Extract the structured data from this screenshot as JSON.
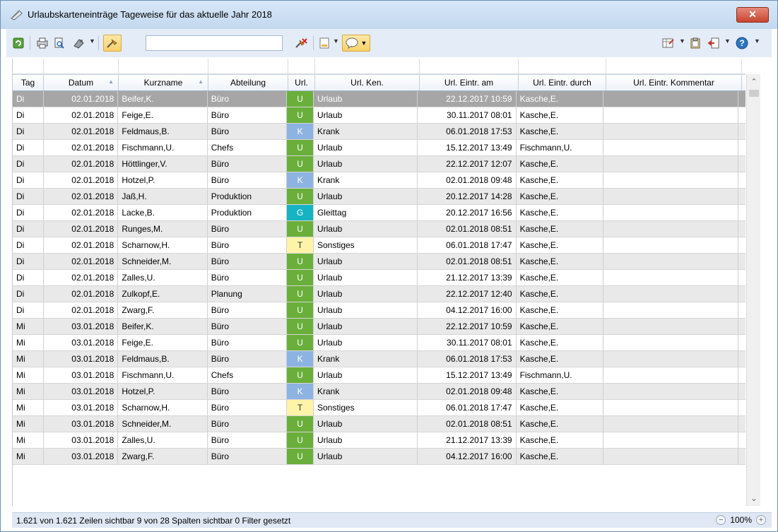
{
  "window": {
    "title": "Urlaubskarteneinträge Tageweise für das aktuelle Jahr 2018",
    "close_label": "x"
  },
  "toolbar": {
    "search_value": "",
    "icons": [
      "refresh-icon",
      "print-icon",
      "print-preview-icon",
      "export-icon",
      "filter-icon",
      "clear-filter-icon",
      "document-icon",
      "comment-icon",
      "layout-icon",
      "clipboard-icon",
      "exit-icon",
      "help-icon"
    ]
  },
  "columns": [
    "Tag",
    "Datum",
    "Kurzname",
    "Abteilung",
    "Url.",
    "Url. Ken.",
    "Url. Eintr. am",
    "Url. Eintr. durch",
    "Url. Eintr. Kommentar"
  ],
  "code_colors": {
    "U": "#6aaf3a",
    "K": "#8db3e2",
    "G": "#16b3c2",
    "T": "#fff3a8"
  },
  "rows": [
    {
      "tag": "Di",
      "datum": "02.01.2018",
      "kurz": "Beifer,K.",
      "abt": "Büro",
      "url": "U",
      "ken": "Urlaub",
      "am": "22.12.2017 10:59",
      "durch": "Kasche,E."
    },
    {
      "tag": "Di",
      "datum": "02.01.2018",
      "kurz": "Feige,E.",
      "abt": "Büro",
      "url": "U",
      "ken": "Urlaub",
      "am": "30.11.2017 08:01",
      "durch": "Kasche,E."
    },
    {
      "tag": "Di",
      "datum": "02.01.2018",
      "kurz": "Feldmaus,B.",
      "abt": "Büro",
      "url": "K",
      "ken": "Krank",
      "am": "06.01.2018 17:53",
      "durch": "Kasche,E."
    },
    {
      "tag": "Di",
      "datum": "02.01.2018",
      "kurz": "Fischmann,U.",
      "abt": "Chefs",
      "url": "U",
      "ken": "Urlaub",
      "am": "15.12.2017 13:49",
      "durch": "Fischmann,U."
    },
    {
      "tag": "Di",
      "datum": "02.01.2018",
      "kurz": "Höttlinger,V.",
      "abt": "Büro",
      "url": "U",
      "ken": "Urlaub",
      "am": "22.12.2017 12:07",
      "durch": "Kasche,E."
    },
    {
      "tag": "Di",
      "datum": "02.01.2018",
      "kurz": "Hotzel,P.",
      "abt": "Büro",
      "url": "K",
      "ken": "Krank",
      "am": "02.01.2018 09:48",
      "durch": "Kasche,E."
    },
    {
      "tag": "Di",
      "datum": "02.01.2018",
      "kurz": "Jaß,H.",
      "abt": "Produktion",
      "url": "U",
      "ken": "Urlaub",
      "am": "20.12.2017 14:28",
      "durch": "Kasche,E."
    },
    {
      "tag": "Di",
      "datum": "02.01.2018",
      "kurz": "Lacke,B.",
      "abt": "Produktion",
      "url": "G",
      "ken": "Gleittag",
      "am": "20.12.2017 16:56",
      "durch": "Kasche,E."
    },
    {
      "tag": "Di",
      "datum": "02.01.2018",
      "kurz": "Runges,M.",
      "abt": "Büro",
      "url": "U",
      "ken": "Urlaub",
      "am": "02.01.2018 08:51",
      "durch": "Kasche,E."
    },
    {
      "tag": "Di",
      "datum": "02.01.2018",
      "kurz": "Scharnow,H.",
      "abt": "Büro",
      "url": "T",
      "ken": "Sonstiges",
      "am": "06.01.2018 17:47",
      "durch": "Kasche,E."
    },
    {
      "tag": "Di",
      "datum": "02.01.2018",
      "kurz": "Schneider,M.",
      "abt": "Büro",
      "url": "U",
      "ken": "Urlaub",
      "am": "02.01.2018 08:51",
      "durch": "Kasche,E."
    },
    {
      "tag": "Di",
      "datum": "02.01.2018",
      "kurz": "Zalles,U.",
      "abt": "Büro",
      "url": "U",
      "ken": "Urlaub",
      "am": "21.12.2017 13:39",
      "durch": "Kasche,E."
    },
    {
      "tag": "Di",
      "datum": "02.01.2018",
      "kurz": "Zulkopf,E.",
      "abt": "Planung",
      "url": "U",
      "ken": "Urlaub",
      "am": "22.12.2017 12:40",
      "durch": "Kasche,E."
    },
    {
      "tag": "Di",
      "datum": "02.01.2018",
      "kurz": "Zwarg,F.",
      "abt": "Büro",
      "url": "U",
      "ken": "Urlaub",
      "am": "04.12.2017 16:00",
      "durch": "Kasche,E."
    },
    {
      "tag": "Mi",
      "datum": "03.01.2018",
      "kurz": "Beifer,K.",
      "abt": "Büro",
      "url": "U",
      "ken": "Urlaub",
      "am": "22.12.2017 10:59",
      "durch": "Kasche,E."
    },
    {
      "tag": "Mi",
      "datum": "03.01.2018",
      "kurz": "Feige,E.",
      "abt": "Büro",
      "url": "U",
      "ken": "Urlaub",
      "am": "30.11.2017 08:01",
      "durch": "Kasche,E."
    },
    {
      "tag": "Mi",
      "datum": "03.01.2018",
      "kurz": "Feldmaus,B.",
      "abt": "Büro",
      "url": "K",
      "ken": "Krank",
      "am": "06.01.2018 17:53",
      "durch": "Kasche,E."
    },
    {
      "tag": "Mi",
      "datum": "03.01.2018",
      "kurz": "Fischmann,U.",
      "abt": "Chefs",
      "url": "U",
      "ken": "Urlaub",
      "am": "15.12.2017 13:49",
      "durch": "Fischmann,U."
    },
    {
      "tag": "Mi",
      "datum": "03.01.2018",
      "kurz": "Hotzel,P.",
      "abt": "Büro",
      "url": "K",
      "ken": "Krank",
      "am": "02.01.2018 09:48",
      "durch": "Kasche,E."
    },
    {
      "tag": "Mi",
      "datum": "03.01.2018",
      "kurz": "Scharnow,H.",
      "abt": "Büro",
      "url": "T",
      "ken": "Sonstiges",
      "am": "06.01.2018 17:47",
      "durch": "Kasche,E."
    },
    {
      "tag": "Mi",
      "datum": "03.01.2018",
      "kurz": "Schneider,M.",
      "abt": "Büro",
      "url": "U",
      "ken": "Urlaub",
      "am": "02.01.2018 08:51",
      "durch": "Kasche,E."
    },
    {
      "tag": "Mi",
      "datum": "03.01.2018",
      "kurz": "Zalles,U.",
      "abt": "Büro",
      "url": "U",
      "ken": "Urlaub",
      "am": "21.12.2017 13:39",
      "durch": "Kasche,E."
    },
    {
      "tag": "Mi",
      "datum": "03.01.2018",
      "kurz": "Zwarg,F.",
      "abt": "Büro",
      "url": "U",
      "ken": "Urlaub",
      "am": "04.12.2017 16:00",
      "durch": "Kasche,E."
    }
  ],
  "status": {
    "text": "1.621 von 1.621 Zeilen sichtbar   9 von 28 Spalten sichtbar   0 Filter gesetzt",
    "zoom": "100%",
    "zoom_out": "−",
    "zoom_in": "+"
  }
}
